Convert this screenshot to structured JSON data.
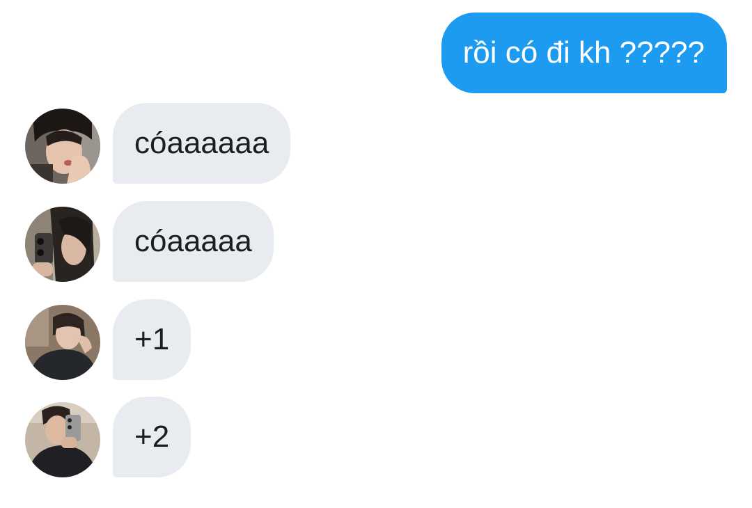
{
  "conversation": {
    "sent_message": {
      "text": "rồi có đi kh ?????"
    },
    "received_messages": [
      {
        "text": "cóaaaaaa",
        "avatar": "user-avatar-1"
      },
      {
        "text": "cóaaaaa",
        "avatar": "user-avatar-2"
      },
      {
        "text": "+1",
        "avatar": "user-avatar-3"
      },
      {
        "text": "+2",
        "avatar": "user-avatar-4"
      }
    ]
  },
  "colors": {
    "sent_bubble": "#1d9bf0",
    "received_bubble": "#e8ecf0",
    "sent_text": "#ffffff",
    "received_text": "#1b1f23",
    "background": "#ffffff"
  }
}
